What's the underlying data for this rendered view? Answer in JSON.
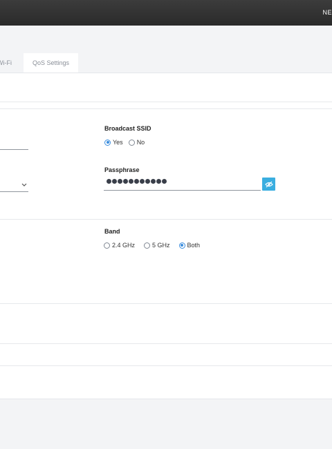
{
  "topbar": {
    "nav_text": "NE"
  },
  "tabs": [
    {
      "label": "Wi-Fi",
      "active": false
    },
    {
      "label": "QoS Settings",
      "active": true
    }
  ],
  "broadcast_ssid": {
    "label": "Broadcast SSID",
    "options": [
      "Yes",
      "No"
    ],
    "selected": "Yes"
  },
  "passphrase": {
    "label": "Passphrase",
    "masked_length": 11
  },
  "band": {
    "label": "Band",
    "options": [
      "2.4 GHz",
      "5 GHz",
      "Both"
    ],
    "selected": "Both"
  },
  "icons": {
    "reveal": "eye-slash-icon",
    "dropdown": "chevron-down-icon"
  },
  "colors": {
    "accent": "#3a8dde",
    "reveal_button": "#3aaee0",
    "topbar": "#2f2f2f"
  }
}
